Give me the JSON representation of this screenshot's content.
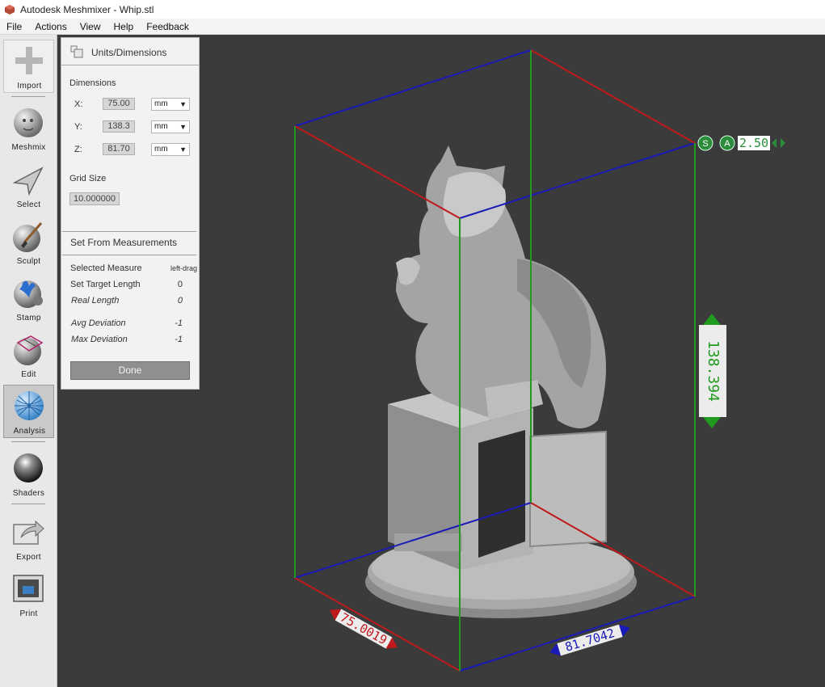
{
  "window": {
    "title": "Autodesk Meshmixer - Whip.stl"
  },
  "menu": [
    "File",
    "Actions",
    "View",
    "Help",
    "Feedback"
  ],
  "toolbar": {
    "import": "Import",
    "meshmix": "Meshmix",
    "select": "Select",
    "sculpt": "Sculpt",
    "stamp": "Stamp",
    "edit": "Edit",
    "analysis": "Analysis",
    "shaders": "Shaders",
    "export": "Export",
    "print": "Print"
  },
  "panel": {
    "title": "Units/Dimensions",
    "dimensions_label": "Dimensions",
    "x_label": "X:",
    "x_value": "75.00",
    "x_unit": "mm",
    "y_label": "Y:",
    "y_value": "138.3",
    "y_unit": "mm",
    "z_label": "Z:",
    "z_value": "81.70",
    "z_unit": "mm",
    "grid_label": "Grid Size",
    "grid_value": "10.000000",
    "set_from_label": "Set From Measurements",
    "selected_measure_label": "Selected Measure",
    "selected_measure_value": "left-drag",
    "target_length_label": "Set Target Length",
    "target_length_value": "0",
    "real_length_label": "Real Length",
    "real_length_value": "0",
    "avg_dev_label": "Avg Deviation",
    "avg_dev_value": "-1",
    "max_dev_label": "Max Deviation",
    "max_dev_value": "-1",
    "done_label": "Done"
  },
  "viewport": {
    "scale_label": "2.50",
    "s_badge": "S",
    "a_badge": "A",
    "height_dim": "138.394",
    "left_dim": "75.0019",
    "right_dim": "81.7042"
  },
  "colors": {
    "axis_x": "#c0191b",
    "axis_y": "#1f9b1f",
    "axis_z": "#1a1ab8",
    "viewport_bg": "#3b3b3b"
  }
}
